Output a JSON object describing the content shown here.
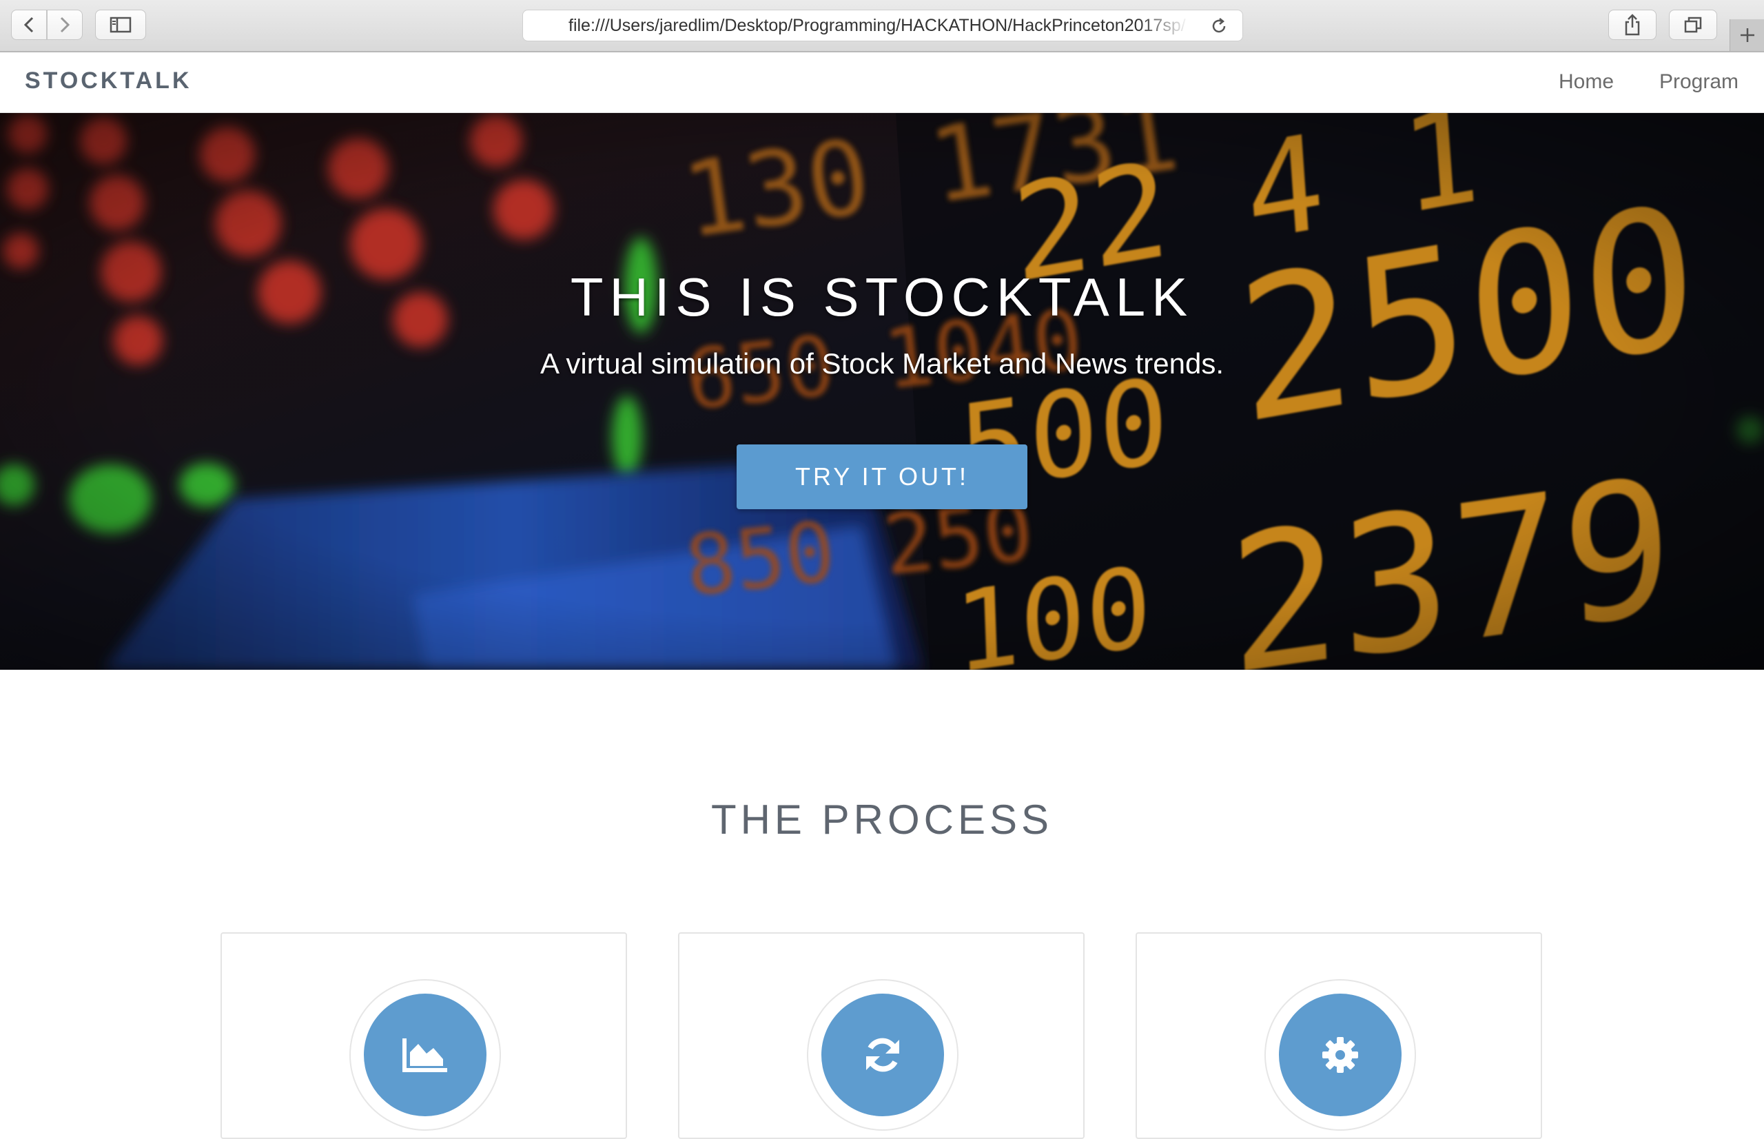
{
  "browser": {
    "url": "file:///Users/jaredlim/Desktop/Programming/HACKATHON/HackPrinceton2017sp/"
  },
  "navbar": {
    "brand": "STOCKTALK",
    "links": [
      {
        "label": "Home"
      },
      {
        "label": "Program"
      }
    ]
  },
  "hero": {
    "title": "THIS IS STOCKTALK",
    "subtitle": "A virtual simulation of Stock Market and News trends.",
    "cta_label": "TRY IT OUT!"
  },
  "process": {
    "title": "THE PROCESS",
    "cards": [
      {
        "icon": "area-chart-icon"
      },
      {
        "icon": "refresh-icon"
      },
      {
        "icon": "gear-icon"
      }
    ]
  },
  "colors": {
    "accent": "#5e9ccf",
    "brand_text": "#5a6470",
    "ticker_orange": "#f5a623",
    "ticker_red": "#e8302a",
    "ticker_green": "#3ccf3c"
  }
}
